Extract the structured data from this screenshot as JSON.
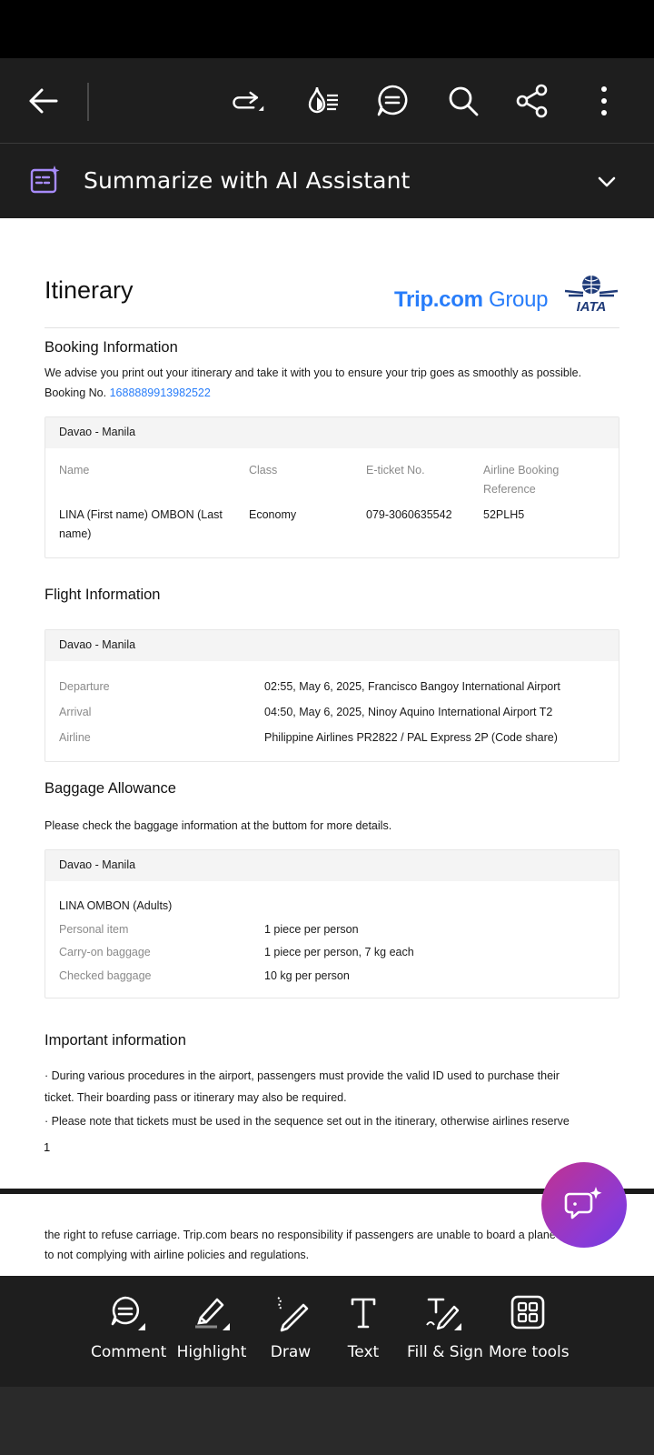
{
  "toolbar": {
    "icons": [
      "back-arrow-icon",
      "redo-icon",
      "reading-mode-icon",
      "comment-list-icon",
      "search-icon",
      "share-icon",
      "more-icon"
    ]
  },
  "ai_bar": {
    "title": "Summarize with AI Assistant"
  },
  "doc": {
    "title": "Itinerary",
    "logo_trip": "Trip.com",
    "logo_group": "Group",
    "logo_iata": "IATA",
    "booking": {
      "heading": "Booking Information",
      "advice": "We advise you print out your itinerary and take it with you to ensure your trip goes as smoothly as possible.",
      "booking_no_label": "Booking No.",
      "booking_no": "1688889913982522",
      "route": "Davao - Manila",
      "col_name": "Name",
      "col_class": "Class",
      "col_eticket": "E-ticket No.",
      "col_ref_1": "Airline Booking",
      "col_ref_2": "Reference",
      "name_1": "LINA (First name) OMBON (Last",
      "name_2": "name)",
      "class": "Economy",
      "eticket": "079-3060635542",
      "ref": "52PLH5"
    },
    "flight": {
      "heading": "Flight Information",
      "route": "Davao - Manila",
      "departure_label": "Departure",
      "departure": "02:55, May 6, 2025, Francisco Bangoy International Airport",
      "arrival_label": "Arrival",
      "arrival": "04:50, May 6, 2025, Ninoy Aquino International Airport T2",
      "airline_label": "Airline",
      "airline": "Philippine Airlines PR2822 / PAL Express 2P (Code share)"
    },
    "baggage": {
      "heading": "Baggage Allowance",
      "note": "Please check the baggage information at the buttom for more details.",
      "route": "Davao - Manila",
      "passenger": "LINA OMBON (Adults)",
      "personal_label": "Personal item",
      "personal": "1 piece per person",
      "carryon_label": "Carry-on baggage",
      "carryon": "1 piece per person, 7 kg each",
      "checked_label": "Checked baggage",
      "checked": "10 kg per person"
    },
    "important": {
      "heading": "Important information",
      "line1": "· During various procedures in the airport, passengers must provide the valid ID used to purchase their",
      "line2": "ticket. Their boarding pass or itinerary may also be required.",
      "line3": "· Please note that tickets must be used in the sequence set out in the itinerary, otherwise airlines reserve"
    },
    "page_number": "1",
    "page2_line1": "the right to refuse carriage. Trip.com bears no responsibility if passengers are unable to board a plane due",
    "page2_line2": "to not complying with airline policies and regulations."
  },
  "bottom_tools": {
    "comment": "Comment",
    "highlight": "Highlight",
    "draw": "Draw",
    "text": "Text",
    "fill_sign": "Fill & Sign",
    "more_tools": "More tools"
  },
  "colors": {
    "accent_link": "#287dfa",
    "fab_start": "#c2318f",
    "fab_end": "#6e3ce0",
    "toolbar_bg": "#1e1e1e"
  }
}
